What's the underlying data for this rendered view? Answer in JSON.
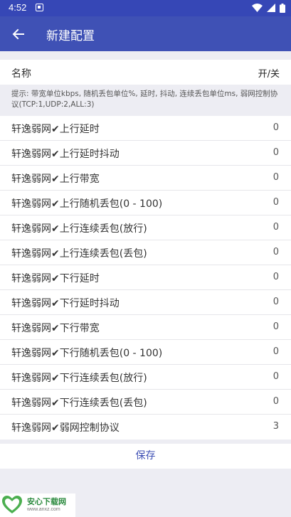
{
  "status_bar": {
    "time": "4:52",
    "icons": [
      "notification-icon",
      "wifi-icon",
      "signal-icon",
      "battery-icon"
    ]
  },
  "app_bar": {
    "title": "新建配置",
    "back_icon": "arrow-left-icon"
  },
  "header": {
    "name_label": "名称",
    "toggle_label": "开/关"
  },
  "hint": "提示: 带宽单位kbps, 随机丢包单位%, 延时, 抖动, 连续丢包单位ms, 弱网控制协议(TCP:1,UDP:2,ALL:3)",
  "rows": [
    {
      "label": "轩逸弱网✔上行延时",
      "value": "0"
    },
    {
      "label": "轩逸弱网✔上行延时抖动",
      "value": "0"
    },
    {
      "label": "轩逸弱网✔上行带宽",
      "value": "0"
    },
    {
      "label": "轩逸弱网✔上行随机丢包(0 - 100)",
      "value": "0"
    },
    {
      "label": "轩逸弱网✔上行连续丢包(放行)",
      "value": "0"
    },
    {
      "label": "轩逸弱网✔上行连续丢包(丢包)",
      "value": "0"
    },
    {
      "label": "轩逸弱网✔下行延时",
      "value": "0"
    },
    {
      "label": "轩逸弱网✔下行延时抖动",
      "value": "0"
    },
    {
      "label": "轩逸弱网✔下行带宽",
      "value": "0"
    },
    {
      "label": "轩逸弱网✔下行随机丢包(0 - 100)",
      "value": "0"
    },
    {
      "label": "轩逸弱网✔下行连续丢包(放行)",
      "value": "0"
    },
    {
      "label": "轩逸弱网✔下行连续丢包(丢包)",
      "value": "0"
    },
    {
      "label": "轩逸弱网✔弱网控制协议",
      "value": "3"
    }
  ],
  "save_label": "保存",
  "watermark": {
    "brand": "安心下载网",
    "url": "www.anxz.com"
  },
  "colors": {
    "app_bar": "#3f51b5",
    "status_bar": "#3647b6",
    "background": "#ededf3",
    "accent_text": "#3f51b5"
  }
}
